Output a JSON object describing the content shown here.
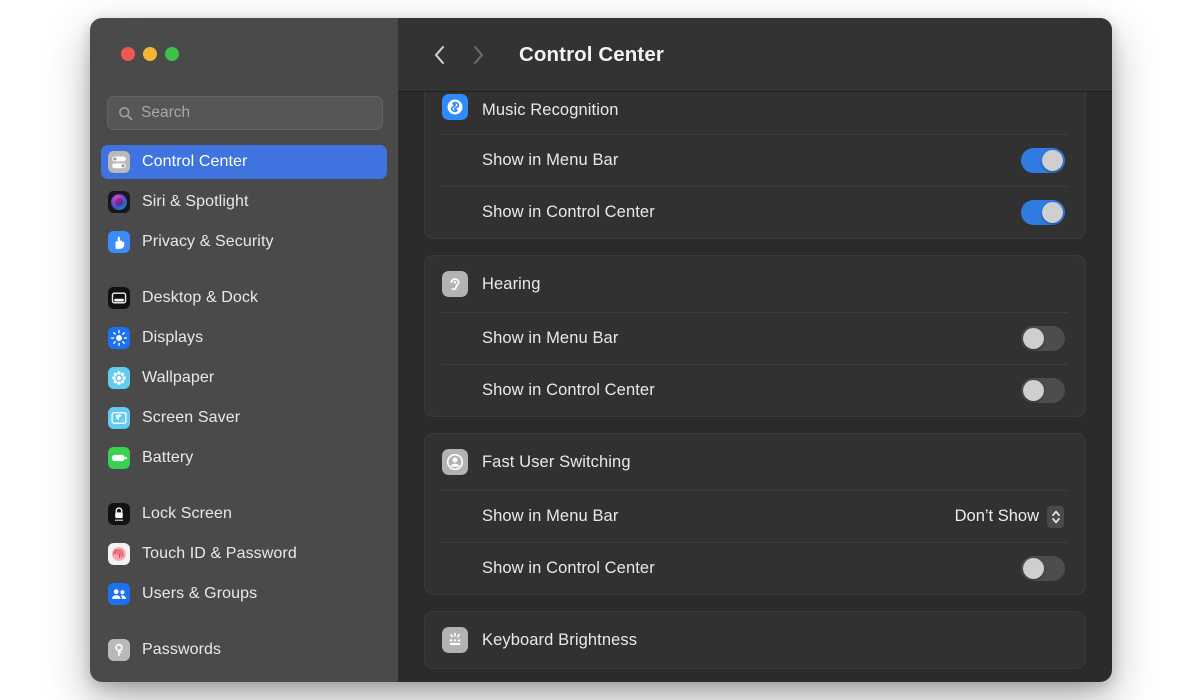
{
  "window": {
    "title": "Control Center",
    "traffic_lights": [
      "close",
      "minimize",
      "maximize"
    ]
  },
  "sidebar": {
    "search": {
      "value": "",
      "placeholder": "Search"
    },
    "items": [
      {
        "label": "Control Center",
        "icon": "control-center-icon",
        "selected": true,
        "gap_after": false
      },
      {
        "label": "Siri & Spotlight",
        "icon": "siri-icon",
        "selected": false,
        "gap_after": false
      },
      {
        "label": "Privacy & Security",
        "icon": "privacy-security-icon",
        "selected": false,
        "gap_after": true
      },
      {
        "label": "Desktop & Dock",
        "icon": "desktop-dock-icon",
        "selected": false,
        "gap_after": false
      },
      {
        "label": "Displays",
        "icon": "displays-icon",
        "selected": false,
        "gap_after": false
      },
      {
        "label": "Wallpaper",
        "icon": "wallpaper-icon",
        "selected": false,
        "gap_after": false
      },
      {
        "label": "Screen Saver",
        "icon": "screen-saver-icon",
        "selected": false,
        "gap_after": false
      },
      {
        "label": "Battery",
        "icon": "battery-icon",
        "selected": false,
        "gap_after": true
      },
      {
        "label": "Lock Screen",
        "icon": "lock-screen-icon",
        "selected": false,
        "gap_after": false
      },
      {
        "label": "Touch ID & Password",
        "icon": "touch-id-icon",
        "selected": false,
        "gap_after": false
      },
      {
        "label": "Users & Groups",
        "icon": "users-groups-icon",
        "selected": false,
        "gap_after": true
      },
      {
        "label": "Passwords",
        "icon": "passwords-icon",
        "selected": false,
        "gap_after": false
      }
    ]
  },
  "toolbar": {
    "back_icon": "chevron-left-icon",
    "forward_icon": "chevron-right-icon",
    "title": "Control Center"
  },
  "main": {
    "groups": [
      {
        "title": "Music Recognition",
        "icon": "shazam-icon",
        "clipped_top": true,
        "rows": [
          {
            "label": "Show in Menu Bar",
            "control": "switch",
            "value": "on"
          },
          {
            "label": "Show in Control Center",
            "control": "switch",
            "value": "on"
          }
        ]
      },
      {
        "title": "Hearing",
        "icon": "hearing-icon",
        "clipped_top": false,
        "rows": [
          {
            "label": "Show in Menu Bar",
            "control": "switch",
            "value": "off"
          },
          {
            "label": "Show in Control Center",
            "control": "switch",
            "value": "off"
          }
        ]
      },
      {
        "title": "Fast User Switching",
        "icon": "fast-user-switching-icon",
        "clipped_top": false,
        "rows": [
          {
            "label": "Show in Menu Bar",
            "control": "popup",
            "value": "Don’t Show"
          },
          {
            "label": "Show in Control Center",
            "control": "switch",
            "value": "off"
          }
        ]
      },
      {
        "title": "Keyboard Brightness",
        "icon": "keyboard-brightness-icon",
        "clipped_top": false,
        "rows": []
      }
    ]
  },
  "colors": {
    "accent_blue": "#2f7be0",
    "selection_blue": "#3f74e0",
    "sidebar_bg": "#4a4a4a",
    "content_bg": "#2b2b2b",
    "group_bg": "#313131",
    "toolbar_bg": "#333333",
    "switch_off": "#4d4d4d",
    "knob": "#cfcfcf",
    "text": "#e9e9e9",
    "traffic_close": "#f1584f",
    "traffic_minimize": "#f2b636",
    "traffic_maximize": "#3cc14a"
  }
}
